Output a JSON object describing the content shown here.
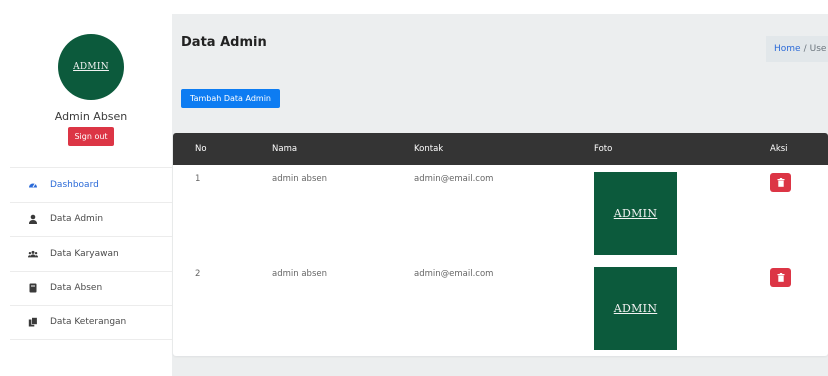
{
  "sidebar": {
    "logo_text": "ADMIN",
    "profile_name": "Admin Absen",
    "signout_label": "Sign out",
    "items": [
      {
        "label": "Dashboard",
        "icon": "tachometer-icon",
        "active": true
      },
      {
        "label": "Data Admin",
        "icon": "user-icon"
      },
      {
        "label": "Data Karyawan",
        "icon": "users-icon"
      },
      {
        "label": "Data Absen",
        "icon": "book-icon"
      },
      {
        "label": "Data Keterangan",
        "icon": "copy-icon"
      }
    ]
  },
  "header": {
    "title": "Data Admin",
    "breadcrumb": {
      "home": "Home",
      "separator": "/",
      "current": "Use"
    }
  },
  "toolbar": {
    "add_label": "Tambah Data Admin"
  },
  "table": {
    "columns": [
      "No",
      "Nama",
      "Kontak",
      "Foto",
      "Aksi"
    ],
    "rows": [
      {
        "no": "1",
        "nama": "admin absen",
        "kontak": "admin@email.com",
        "foto_text": "ADMIN",
        "action_icon": "trash-icon"
      },
      {
        "no": "2",
        "nama": "admin absen",
        "kontak": "admin@email.com",
        "foto_text": "ADMIN",
        "action_icon": "trash-icon"
      }
    ]
  },
  "colors": {
    "primary": "#0d7cf2",
    "danger": "#dc3545",
    "logo_green": "#0c5a3c",
    "table_header": "#343434",
    "active_link": "#2c6bd8",
    "content_bg": "#eceeef"
  }
}
